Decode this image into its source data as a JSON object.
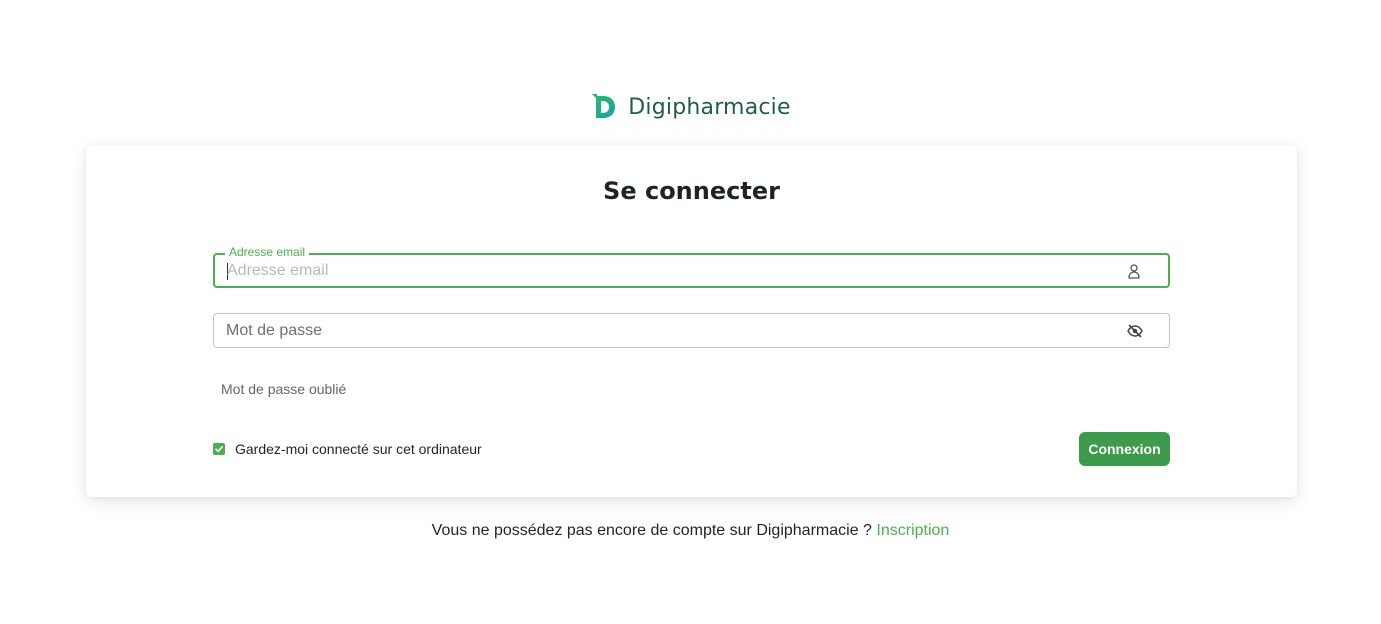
{
  "brand": {
    "name": "Digipharmacie",
    "logo_icon": "digipharmacie-d-logo-icon",
    "color": "#1f5e4a"
  },
  "login": {
    "title": "Se connecter",
    "email": {
      "label": "Adresse email",
      "placeholder": "Adresse email",
      "value": "",
      "icon": "user-icon"
    },
    "password": {
      "placeholder": "Mot de passe",
      "value": "",
      "icon": "eye-off-icon"
    },
    "forgot_label": "Mot de passe oublié",
    "remember": {
      "label": "Gardez-moi connecté sur cet ordinateur",
      "checked": true
    },
    "submit_label": "Connexion"
  },
  "signup": {
    "text": "Vous ne possédez pas encore de compte sur Digipharmacie ?",
    "link_label": "Inscription"
  },
  "colors": {
    "accent": "#4caf50",
    "button": "#3e9a4c"
  }
}
